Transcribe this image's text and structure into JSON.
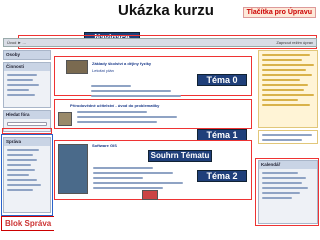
{
  "title": "Ukázka kurzu",
  "callouts": {
    "top_right": "Tlačítka pro Úpravu",
    "navigace": "Navigace",
    "tema0": "Téma 0",
    "tema1": "Téma 1",
    "souhrn": "Souhrn Tématu",
    "tema2": "Téma 2",
    "blok_sprava": "Blok Správa"
  },
  "topbar": {
    "breadcrumb": "Úvod ► ...",
    "edit": "Zapnout režim úprav"
  },
  "left_blocks": [
    {
      "head": "Osoby"
    },
    {
      "head": "Činnosti"
    },
    {
      "head": "Hledat fóra"
    },
    {
      "head": "Správa"
    }
  ],
  "sections": {
    "s0_title": "Základy školství a dějiny fyziky",
    "s0_sub": "Letošní plán",
    "s1_title": "Přírodovědné učitelství - úvod do problematiky",
    "s2_title": "Software GIS",
    "s2_sub": "Souhrn Tématu"
  },
  "right_panel": {
    "calendar_head": "Kalendář",
    "news_head": "Novinky"
  },
  "colors": {
    "accent_red": "#e33333",
    "accent_blue": "#2a62c9",
    "callout_dark": "#1f3f7a"
  }
}
